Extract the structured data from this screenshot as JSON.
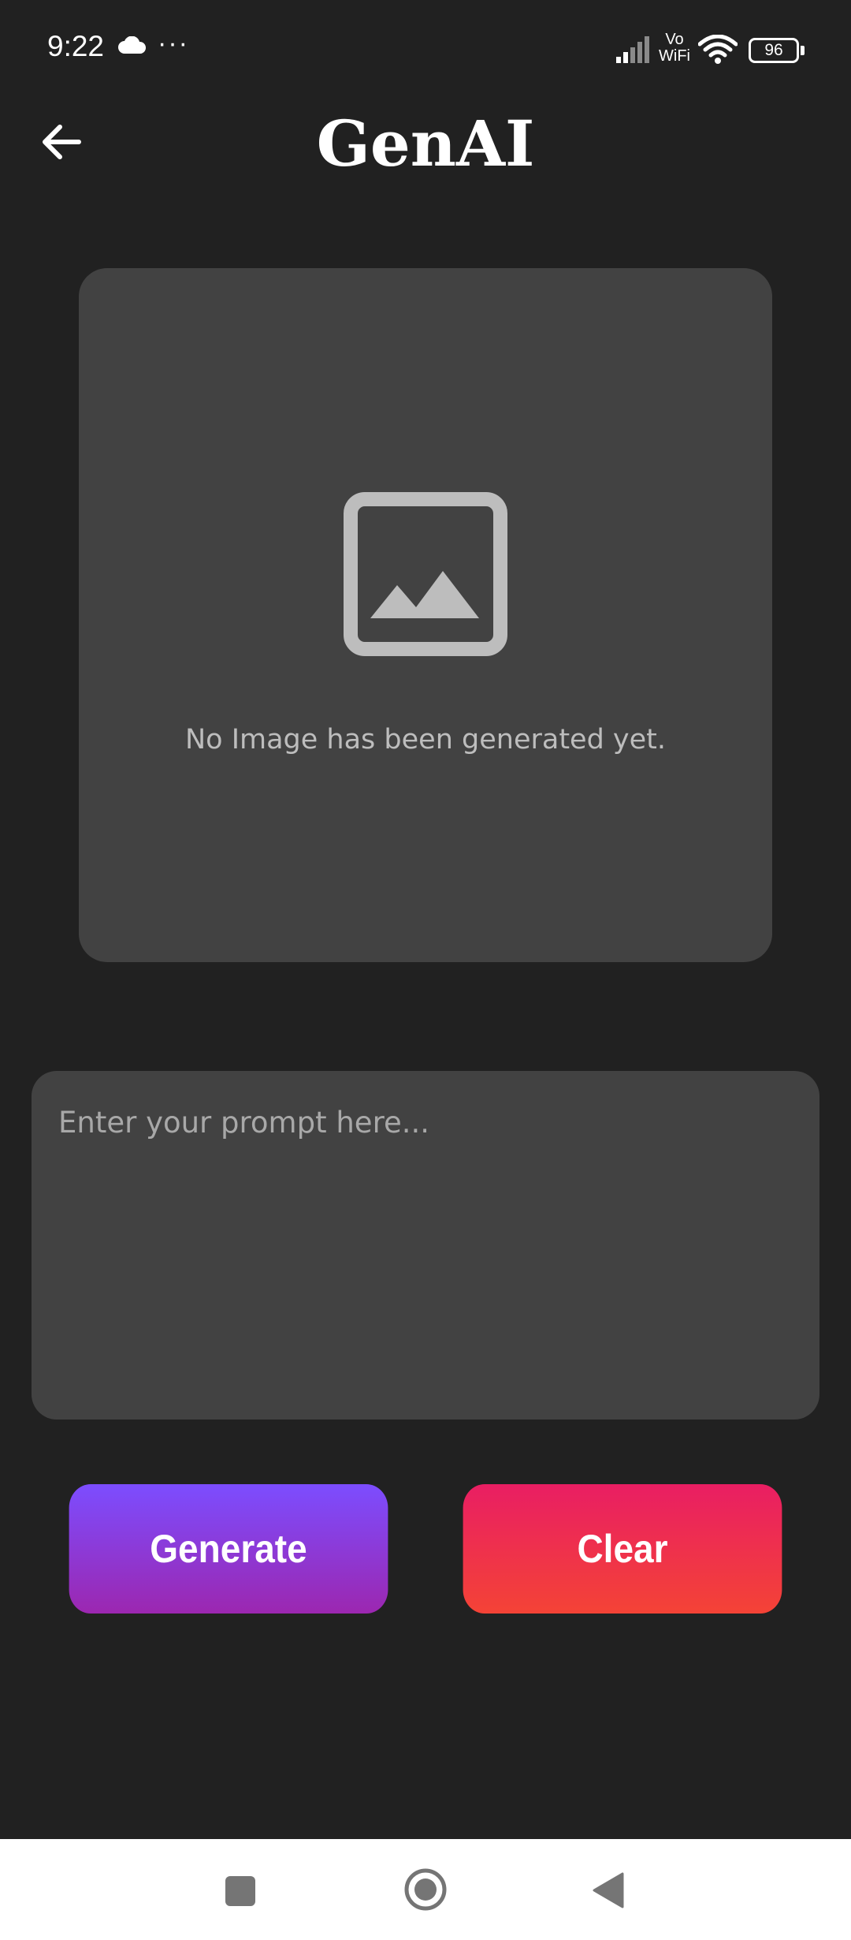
{
  "status_bar": {
    "time": "9:22",
    "more": "···",
    "vo": "Vo",
    "wifi_label": "WiFi",
    "battery": "96"
  },
  "header": {
    "title": "GenAI",
    "back_icon": "arrow-left-icon"
  },
  "image_panel": {
    "icon": "image-placeholder-icon",
    "empty_text": "No Image has been generated yet."
  },
  "prompt": {
    "placeholder": "Enter your prompt here...",
    "value": ""
  },
  "actions": {
    "generate_label": "Generate",
    "clear_label": "Clear"
  },
  "colors": {
    "background": "#212121",
    "card": "#424242",
    "generate_gradient": [
      "#7c4dff",
      "#9c27b0"
    ],
    "clear_gradient": [
      "#e91e63",
      "#f44336"
    ]
  },
  "nav_bar": {
    "icons": [
      "recents-icon",
      "home-icon",
      "back-triangle-icon"
    ]
  }
}
